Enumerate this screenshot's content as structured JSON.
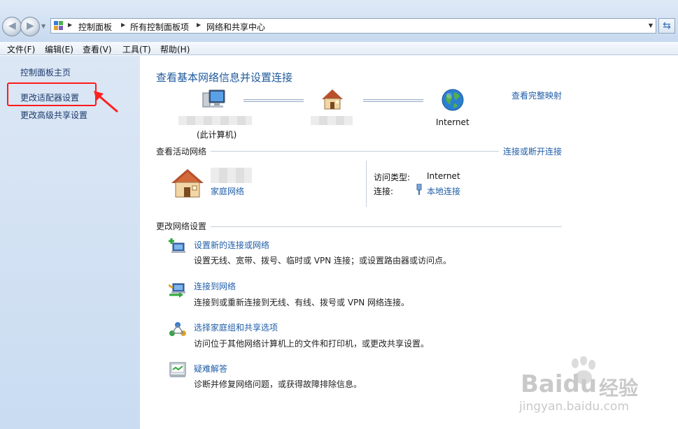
{
  "address_bar": {
    "breadcrumbs": [
      "控制面板",
      "所有控制面板项",
      "网络和共享中心"
    ],
    "nav_icons": [
      "back-icon",
      "forward-icon",
      "history-dropdown-icon"
    ],
    "refresh_icon": "refresh-icon"
  },
  "menubar": {
    "items": [
      "文件(F)",
      "编辑(E)",
      "查看(V)",
      "工具(T)",
      "帮助(H)"
    ]
  },
  "sidebar": {
    "items": [
      {
        "label": "控制面板主页"
      },
      {
        "label": "更改适配器设置"
      },
      {
        "label": "更改高级共享设置"
      }
    ],
    "highlight_color": "#ff1a1a"
  },
  "main": {
    "title": "查看基本网络信息并设置连接",
    "see_full_map": "查看完整映射",
    "network_map": {
      "computer_caption": "(此计算机)",
      "internet_caption": "Internet"
    },
    "active_networks": {
      "heading": "查看活动网络",
      "connect_disconnect": "连接或断开连接",
      "network_type": "家庭网络",
      "access_type_label": "访问类型:",
      "access_type_value": "Internet",
      "connection_label": "连接:",
      "connection_value": "本地连接"
    },
    "change_settings": {
      "heading": "更改网络设置",
      "tasks": [
        {
          "link": "设置新的连接或网络",
          "desc": "设置无线、宽带、拨号、临时或 VPN 连接；或设置路由器或访问点。",
          "icon": "new-connection-icon"
        },
        {
          "link": "连接到网络",
          "desc": "连接到或重新连接到无线、有线、拨号或 VPN 网络连接。",
          "icon": "connect-network-icon"
        },
        {
          "link": "选择家庭组和共享选项",
          "desc": "访问位于其他网络计算机上的文件和打印机，或更改共享设置。",
          "icon": "homegroup-icon"
        },
        {
          "link": "疑难解答",
          "desc": "诊断并修复网络问题，或获得故障排除信息。",
          "icon": "troubleshoot-icon"
        }
      ]
    }
  },
  "watermark": {
    "brand": "Baidu",
    "brand_suffix": "经验",
    "url": "jingyan.baidu.com"
  },
  "colors": {
    "link": "#1f5da8",
    "title": "#1e5a9c",
    "sidebar_bg": "#d4e3f4"
  }
}
